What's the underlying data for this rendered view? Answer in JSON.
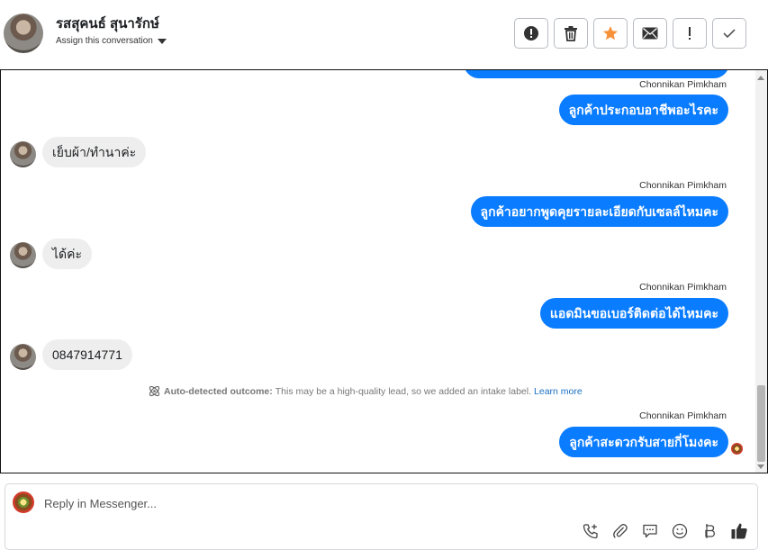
{
  "header": {
    "contact_name": "รสสุคนธ์ สุนารักษ์",
    "assign_label": "Assign this conversation",
    "toolbar": [
      {
        "name": "spam-button",
        "icon": "alert-circle-icon"
      },
      {
        "name": "delete-button",
        "icon": "trash-icon"
      },
      {
        "name": "star-button",
        "icon": "star-icon"
      },
      {
        "name": "mark-unread-button",
        "icon": "envelope-icon"
      },
      {
        "name": "follow-up-button",
        "icon": "exclamation-icon"
      },
      {
        "name": "mark-done-button",
        "icon": "check-icon"
      }
    ],
    "star_color": "#f7923a"
  },
  "messages": [
    {
      "from": "page",
      "sender": "Chonnikan Pimkham",
      "text": "ลูกค้าประกอบอาชีพอะไรคะ"
    },
    {
      "from": "customer",
      "text": "เย็บผ้า/ทำนาค่ะ"
    },
    {
      "from": "page",
      "sender": "Chonnikan Pimkham",
      "text": "ลูกค้าอยากพูดคุยรายละเอียดกับเซลล์ไหมคะ"
    },
    {
      "from": "customer",
      "text": "ได้ค่ะ"
    },
    {
      "from": "page",
      "sender": "Chonnikan Pimkham",
      "text": "แอดมินขอเบอร์ติดต่อได้ไหมคะ"
    },
    {
      "from": "customer",
      "text": "0847914771"
    },
    {
      "from": "page",
      "sender": "Chonnikan Pimkham",
      "text": "ลูกค้าสะดวกรับสายกี่โมงคะ"
    }
  ],
  "outcome": {
    "label": "Auto-detected outcome:",
    "text": "This may be a high-quality lead, so we added an intake label.",
    "link": "Learn more"
  },
  "composer": {
    "placeholder": "Reply in Messenger..."
  },
  "colors": {
    "outgoing_bubble": "#0a7cff",
    "incoming_bubble": "#eeeeee",
    "link": "#1a6fc2"
  }
}
